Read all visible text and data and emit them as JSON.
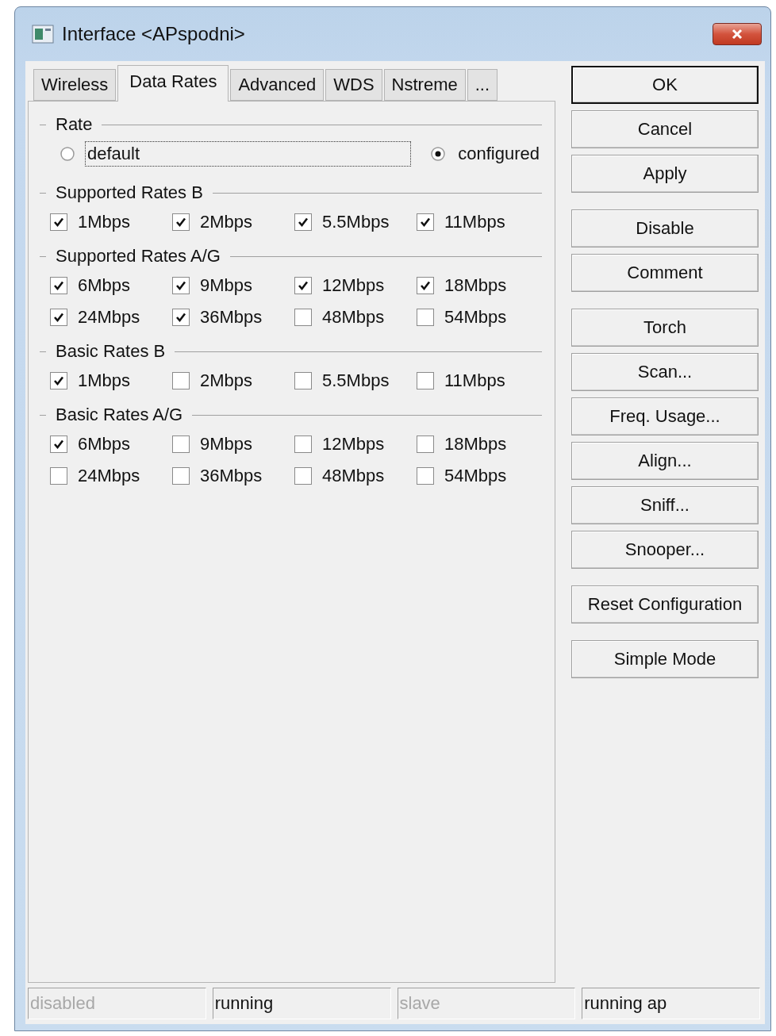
{
  "window": {
    "title": "Interface <APspodni>"
  },
  "tabs": [
    {
      "label": "Wireless",
      "selected": false
    },
    {
      "label": "Data Rates",
      "selected": true
    },
    {
      "label": "Advanced",
      "selected": false
    },
    {
      "label": "WDS",
      "selected": false
    },
    {
      "label": "Nstreme",
      "selected": false
    },
    {
      "label": "...",
      "selected": false
    }
  ],
  "sections": [
    {
      "title": "Rate",
      "kind": "radio",
      "options": [
        {
          "label": "default",
          "selected": false,
          "focused": true
        },
        {
          "label": "configured",
          "selected": true,
          "focused": false
        }
      ]
    },
    {
      "title": "Supported Rates B",
      "kind": "checkboxes",
      "items": [
        {
          "label": "1Mbps",
          "checked": true
        },
        {
          "label": "2Mbps",
          "checked": true
        },
        {
          "label": "5.5Mbps",
          "checked": true
        },
        {
          "label": "11Mbps",
          "checked": true
        }
      ]
    },
    {
      "title": "Supported Rates A/G",
      "kind": "checkboxes",
      "items": [
        {
          "label": "6Mbps",
          "checked": true
        },
        {
          "label": "9Mbps",
          "checked": true
        },
        {
          "label": "12Mbps",
          "checked": true
        },
        {
          "label": "18Mbps",
          "checked": true
        },
        {
          "label": "24Mbps",
          "checked": true
        },
        {
          "label": "36Mbps",
          "checked": true
        },
        {
          "label": "48Mbps",
          "checked": false
        },
        {
          "label": "54Mbps",
          "checked": false
        }
      ]
    },
    {
      "title": "Basic Rates B",
      "kind": "checkboxes",
      "items": [
        {
          "label": "1Mbps",
          "checked": true
        },
        {
          "label": "2Mbps",
          "checked": false
        },
        {
          "label": "5.5Mbps",
          "checked": false
        },
        {
          "label": "11Mbps",
          "checked": false
        }
      ]
    },
    {
      "title": "Basic Rates A/G",
      "kind": "checkboxes",
      "items": [
        {
          "label": "6Mbps",
          "checked": true
        },
        {
          "label": "9Mbps",
          "checked": false
        },
        {
          "label": "12Mbps",
          "checked": false
        },
        {
          "label": "18Mbps",
          "checked": false
        },
        {
          "label": "24Mbps",
          "checked": false
        },
        {
          "label": "36Mbps",
          "checked": false
        },
        {
          "label": "48Mbps",
          "checked": false
        },
        {
          "label": "54Mbps",
          "checked": false
        }
      ]
    }
  ],
  "button_groups": [
    [
      {
        "label": "OK",
        "default": true
      },
      {
        "label": "Cancel",
        "default": false
      },
      {
        "label": "Apply",
        "default": false
      }
    ],
    [
      {
        "label": "Disable",
        "default": false
      },
      {
        "label": "Comment",
        "default": false
      }
    ],
    [
      {
        "label": "Torch",
        "default": false
      },
      {
        "label": "Scan...",
        "default": false
      },
      {
        "label": "Freq. Usage...",
        "default": false
      },
      {
        "label": "Align...",
        "default": false
      },
      {
        "label": "Sniff...",
        "default": false
      },
      {
        "label": "Snooper...",
        "default": false
      }
    ],
    [
      {
        "label": "Reset Configuration",
        "default": false
      }
    ],
    [
      {
        "label": "Simple Mode",
        "default": false
      }
    ]
  ],
  "status_bar": [
    {
      "text": "disabled",
      "disabled": true
    },
    {
      "text": "running",
      "disabled": false
    },
    {
      "text": "slave",
      "disabled": true
    },
    {
      "text": "running ap",
      "disabled": false
    }
  ]
}
